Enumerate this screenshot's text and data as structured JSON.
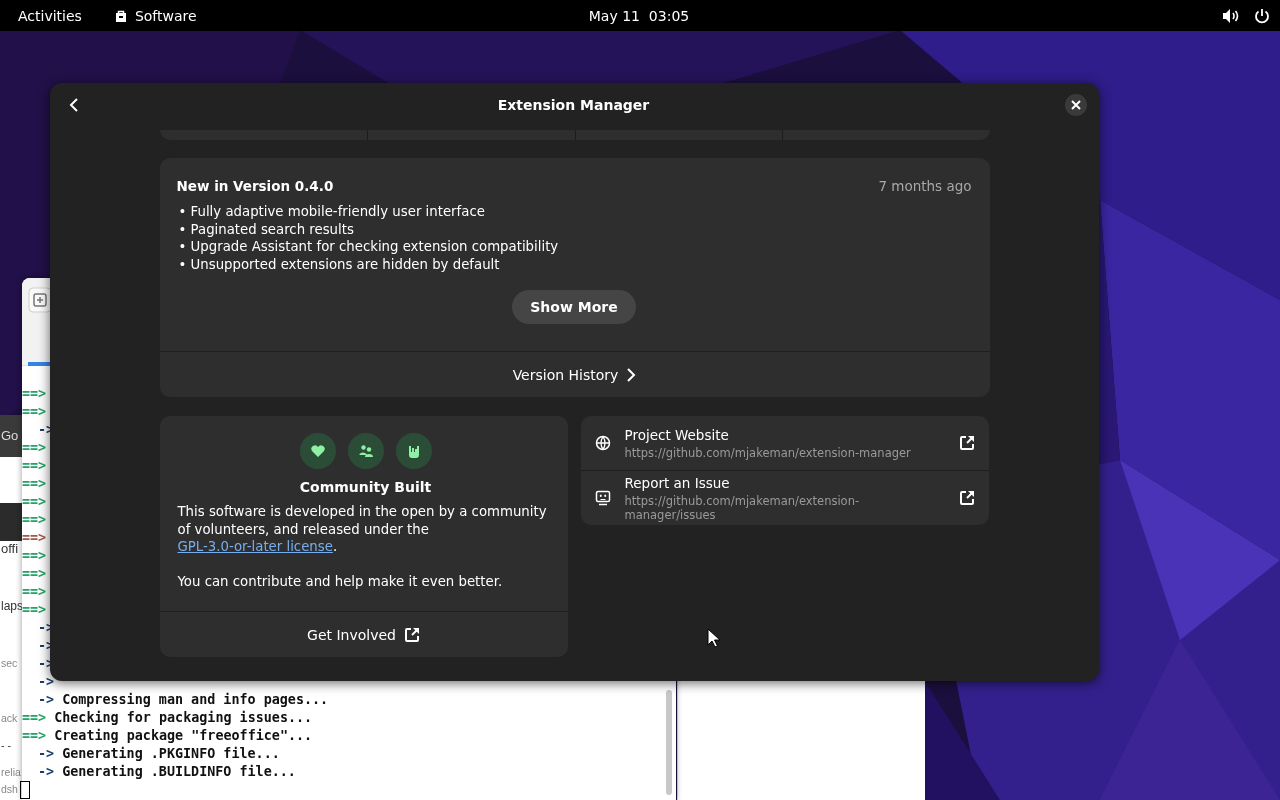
{
  "top_bar": {
    "activities": "Activities",
    "app_menu": "Software",
    "clock": "May 11  03:05"
  },
  "background_browser": {
    "texts": [
      "Go",
      "offi",
      "laps",
      "sec",
      "ack",
      "- -",
      "relia",
      "dsh"
    ]
  },
  "terminal": {
    "lines": [
      {
        "kind": "stage",
        "prompt": "==>"
      },
      {
        "kind": "stage",
        "prompt": "==>"
      },
      {
        "kind": "step",
        "prompt": "->"
      },
      {
        "kind": "stage",
        "prompt": "==>"
      },
      {
        "kind": "stage",
        "prompt": "==>"
      },
      {
        "kind": "stage",
        "prompt": "==>"
      },
      {
        "kind": "stage",
        "prompt": "==>"
      },
      {
        "kind": "stage",
        "prompt": "==>"
      },
      {
        "kind": "warning",
        "prompt": "==>"
      },
      {
        "kind": "stage",
        "prompt": "==>"
      },
      {
        "kind": "stage",
        "prompt": "==>"
      },
      {
        "kind": "stage",
        "prompt": "==>"
      },
      {
        "kind": "stage",
        "prompt": "==>"
      },
      {
        "kind": "step",
        "prompt": "->"
      },
      {
        "kind": "step",
        "prompt": "->"
      },
      {
        "kind": "step",
        "prompt": "->"
      },
      {
        "kind": "step",
        "prompt": "->"
      },
      {
        "kind": "step",
        "prompt": "->",
        "text": "Compressing man and info pages..."
      },
      {
        "kind": "stage",
        "prompt": "==>",
        "text": "Checking for packaging issues..."
      },
      {
        "kind": "stage",
        "prompt": "==>",
        "text": "Creating package \"freeoffice\"..."
      },
      {
        "kind": "step",
        "prompt": "->",
        "text": "Generating .PKGINFO file..."
      },
      {
        "kind": "step",
        "prompt": "->",
        "text": "Generating .BUILDINFO file..."
      }
    ]
  },
  "dialog": {
    "title": "Extension Manager",
    "release": {
      "title": "New in Version 0.4.0",
      "date": "7 months ago",
      "notes": [
        "• Fully adaptive mobile-friendly user interface",
        "• Paginated search results",
        "• Upgrade Assistant for checking extension compatibility",
        "• Unsupported extensions are hidden by default"
      ],
      "show_more": "Show More",
      "history": "Version History"
    },
    "community": {
      "title": "Community Built",
      "text": "This software is developed in the open by a community of volunteers, and released under the ",
      "link": "GPL-3.0-or-later license",
      "after": ".",
      "note": "You can contribute and help make it even better.",
      "action": "Get Involved"
    },
    "links": [
      {
        "kind": "website",
        "title": "Project Website",
        "url": "https://github.com/mjakeman/extension-manager"
      },
      {
        "kind": "issue",
        "title": "Report an Issue",
        "url": "https://github.com/mjakeman/extension-manager/issues"
      }
    ]
  }
}
